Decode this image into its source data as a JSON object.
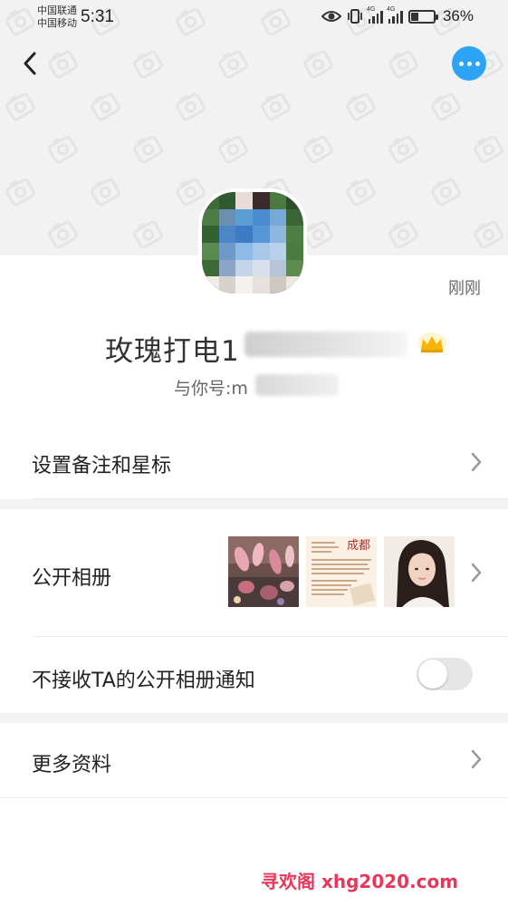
{
  "status_bar": {
    "carrier_1": "中国联通",
    "carrier_2": "中国移动",
    "time": "5:31",
    "signal_tag": "4G",
    "battery": "36%",
    "battery_level": 0.36,
    "icons": [
      "eye-icon",
      "vibrate-icon",
      "signal-icon",
      "battery-charging-icon"
    ]
  },
  "header": {
    "back_icon": "chevron-left-icon",
    "more_icon": "more-dots-icon",
    "accent_color": "#2da3f5"
  },
  "profile": {
    "last_seen": "刚刚",
    "nickname": "玫瑰打电1",
    "wechat_id_label": "与你号:m"
  },
  "menu": {
    "remark_label": "设置备注和星标",
    "album_label": "公开相册",
    "album_notify_label": "不接收TA的公开相册通知",
    "album_notify_enabled": false,
    "more_info_label": "更多资料",
    "thumb_2_title": "成都"
  },
  "watermark": "寻欢阁 xhg2020.com"
}
